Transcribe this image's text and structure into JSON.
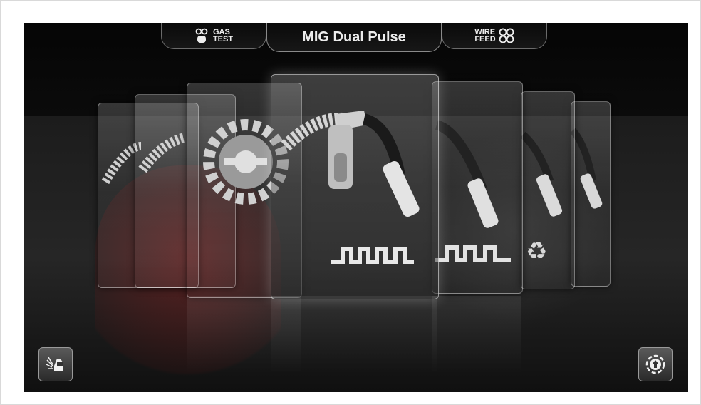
{
  "header": {
    "gas_test_label_line1": "GAS",
    "gas_test_label_line2": "TEST",
    "mode_title": "MIG Dual Pulse",
    "wire_feed_label_line1": "WIRE",
    "wire_feed_label_line2": "FEED"
  },
  "icons": {
    "gas_test": "gas-cylinder-icon",
    "wire_feed": "wire-spool-icon",
    "welder": "welder-icon",
    "upload": "upload-circle-icon"
  },
  "colors": {
    "screen_bg": "#0b0b0b",
    "watermark_red": "#b41e1e",
    "text": "#ececec"
  }
}
